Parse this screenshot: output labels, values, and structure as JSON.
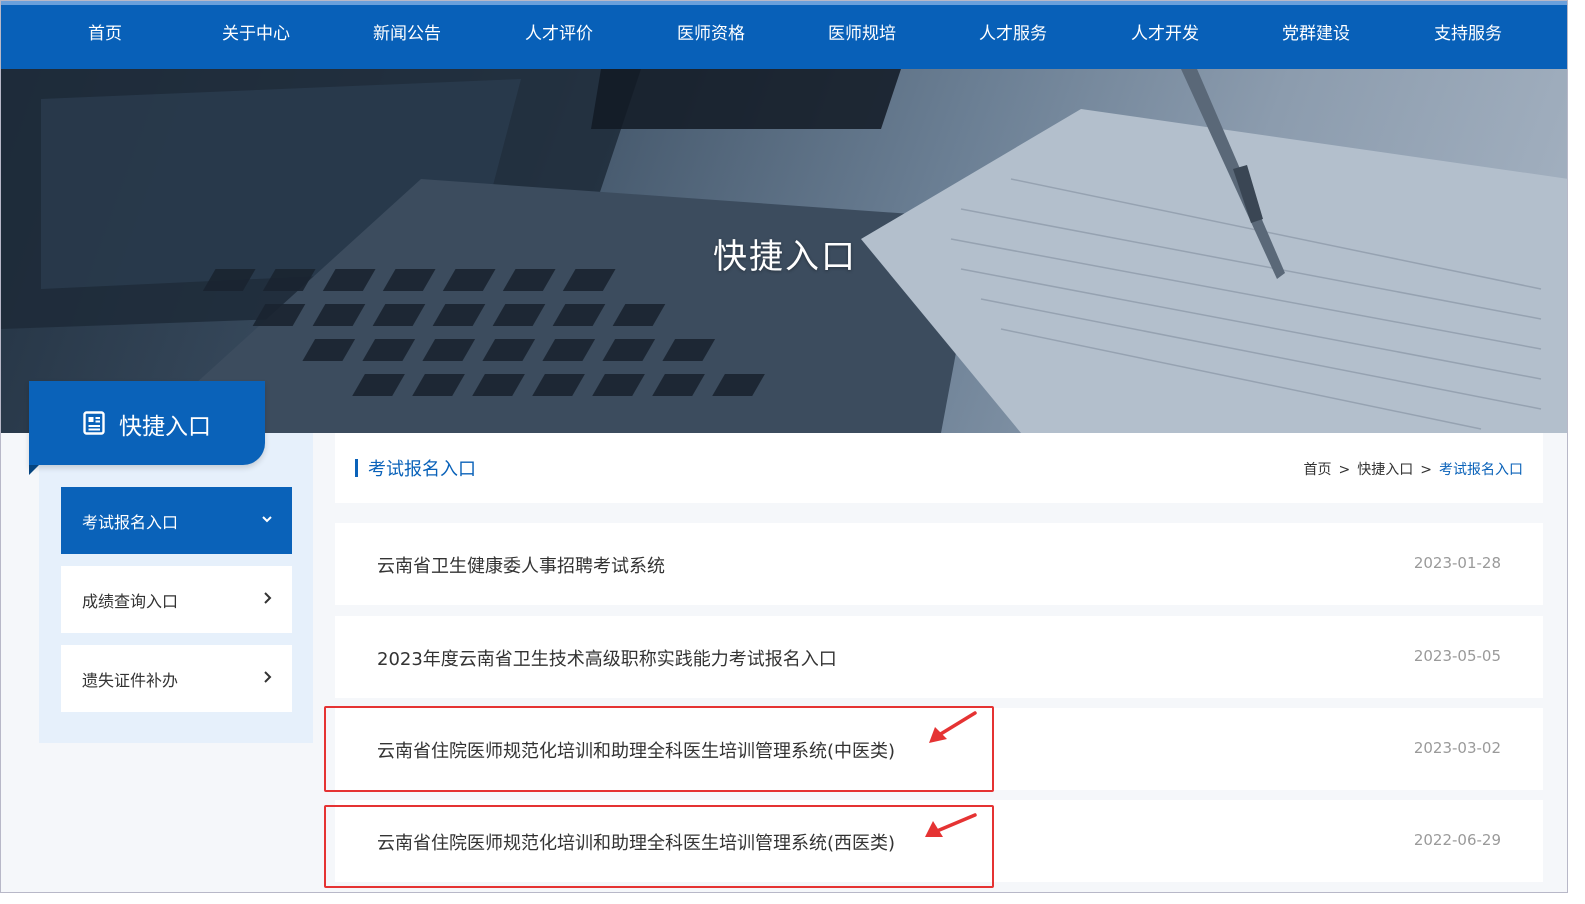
{
  "nav": {
    "items": [
      "首页",
      "关于中心",
      "新闻公告",
      "人才评价",
      "医师资格",
      "医师规培",
      "人才服务",
      "人才开发",
      "党群建设",
      "支持服务"
    ]
  },
  "banner": {
    "title": "快捷入口"
  },
  "sidebar": {
    "header_title": "快捷入口",
    "header_icon": "document-icon",
    "items": [
      {
        "label": "考试报名入口",
        "active": true,
        "icon": "chevron-down-icon"
      },
      {
        "label": "成绩查询入口",
        "active": false,
        "icon": "chevron-right-icon"
      },
      {
        "label": "遗失证件补办",
        "active": false,
        "icon": "chevron-right-icon"
      }
    ]
  },
  "section": {
    "title": "考试报名入口",
    "breadcrumb": [
      "首页",
      "快捷入口",
      "考试报名入口"
    ],
    "breadcrumb_separator": ">"
  },
  "list": [
    {
      "title": "云南省卫生健康委人事招聘考试系统",
      "date": "2023-01-28",
      "highlighted": false
    },
    {
      "title": "2023年度云南省卫生技术高级职称实践能力考试报名入口",
      "date": "2023-05-05",
      "highlighted": false
    },
    {
      "title": "云南省住院医师规范化培训和助理全科医生培训管理系统(中医类)",
      "date": "2023-03-02",
      "highlighted": true
    },
    {
      "title": "云南省住院医师规范化培训和助理全科医生培训管理系统(西医类)",
      "date": "2022-06-29",
      "highlighted": true
    }
  ],
  "colors": {
    "brand_blue": "#0a62b9",
    "nav_blue": "#0860b8",
    "annotation_red": "#e53333",
    "date_gray": "#9a9a9a"
  }
}
